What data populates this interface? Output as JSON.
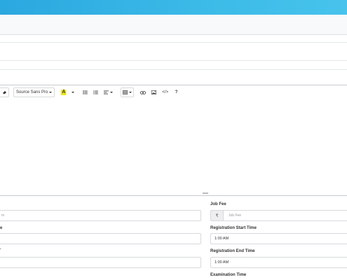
{
  "editor": {
    "font_family_label": "Source Sans Pro",
    "font_color_glyph": "A",
    "code_view_label": "</>",
    "help_label": "?"
  },
  "form": {
    "left_first_partial_placeholder": "m",
    "left_second_partial_label": "e",
    "left_third_partial_label": ".",
    "job_fee_label": "Job Fee",
    "currency_symbol": "₹",
    "job_fee_placeholder": "Job Fee",
    "registration_start_time_label": "Registration Start Time",
    "registration_start_time_value": "1:00 AM",
    "registration_end_time_label": "Registration End Time",
    "registration_end_time_value": "1:00 AM",
    "examination_time_label": "Examination Time"
  },
  "colors": {
    "topbar_start": "#2aa8e0",
    "topbar_end": "#47c3ec",
    "highlight_yellow": "#f5e600"
  }
}
